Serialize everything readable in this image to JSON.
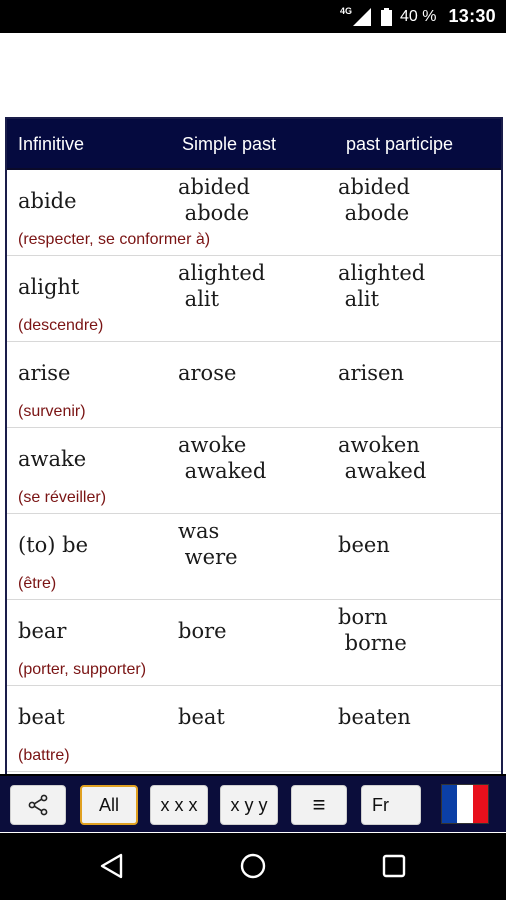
{
  "status_bar": {
    "network": "4G",
    "battery": "40 %",
    "time": "13:30"
  },
  "table": {
    "headers": [
      "Infinitive",
      "Simple past",
      "past participe"
    ],
    "rows": [
      {
        "infinitive": "abide",
        "past": "abided\n abode",
        "participle": "abided\n abode",
        "translation": "(respecter, se conformer à)"
      },
      {
        "infinitive": "alight",
        "past": "alighted\n alit",
        "participle": "alighted\n alit",
        "translation": "(descendre)"
      },
      {
        "infinitive": "arise",
        "past": "arose",
        "participle": "arisen",
        "translation": "(survenir)"
      },
      {
        "infinitive": "awake",
        "past": "awoke\n awaked",
        "participle": "awoken\n awaked",
        "translation": "(se réveiller)"
      },
      {
        "infinitive": "(to) be",
        "past": "was\n were",
        "participle": "been",
        "translation": "(être)"
      },
      {
        "infinitive": "bear",
        "past": "bore",
        "participle": "born\n borne",
        "translation": "(porter, supporter)"
      },
      {
        "infinitive": "beat",
        "past": "beat",
        "participle": "beaten",
        "translation": "(battre)"
      }
    ]
  },
  "toolbar": {
    "share_icon": "share-icon",
    "all_label": "All",
    "xxx_label": "x x x",
    "xyy_label": "x y y",
    "list_icon": "≡",
    "fr_label": "Fr",
    "flag_colors": [
      "#0b3fa6",
      "#ffffff",
      "#e8101c"
    ]
  },
  "nav": {
    "back_icon": "back-icon",
    "home_icon": "home-icon",
    "recents_icon": "recents-icon"
  }
}
